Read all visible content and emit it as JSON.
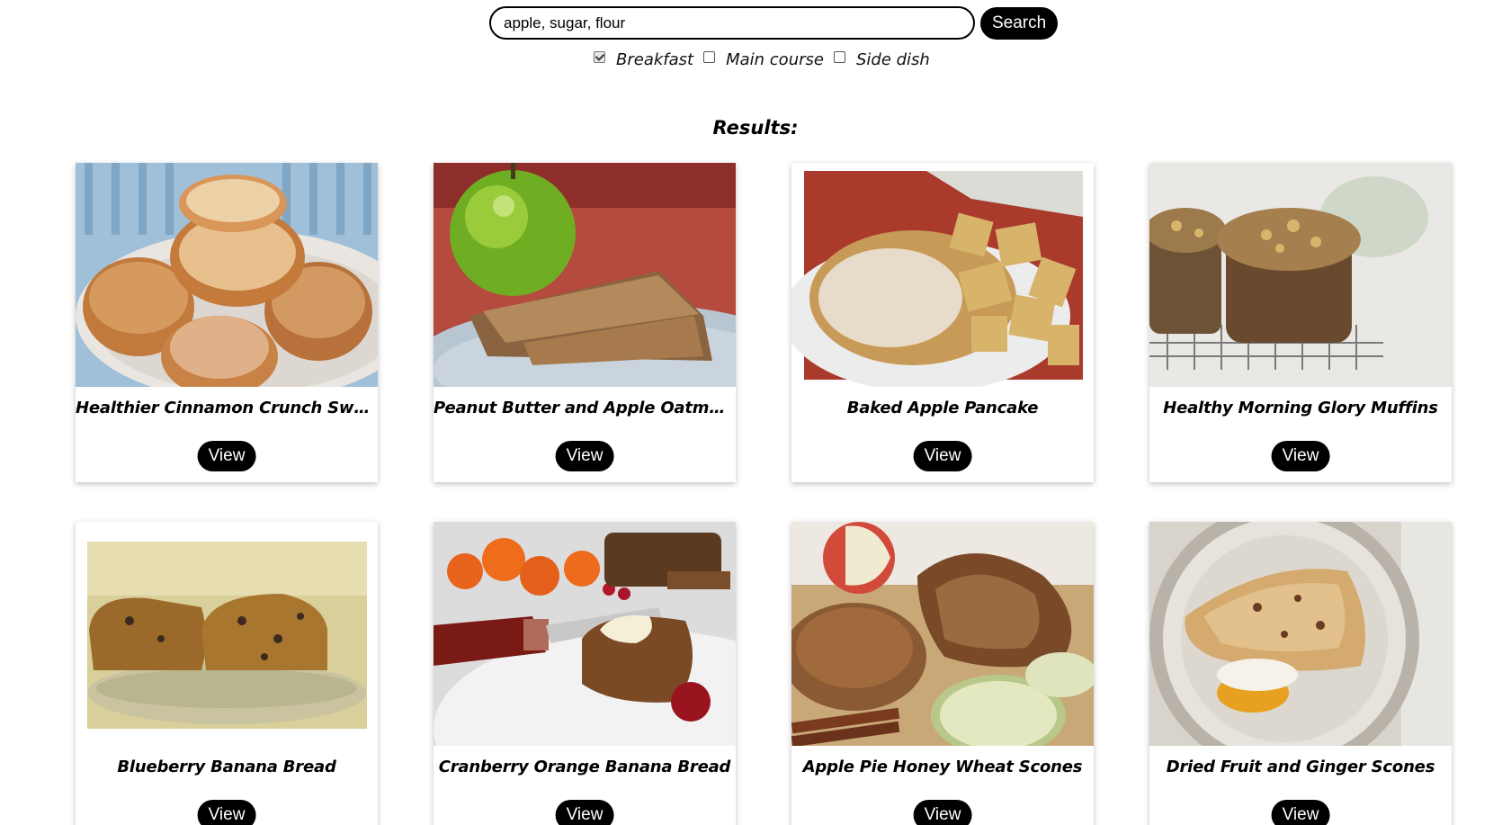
{
  "search": {
    "value": "apple, sugar, flour",
    "button_label": "Search"
  },
  "filters": [
    {
      "label": "Breakfast",
      "checked": true
    },
    {
      "label": "Main course",
      "checked": false
    },
    {
      "label": "Side dish",
      "checked": false
    }
  ],
  "results_heading": "Results:",
  "recipes": [
    {
      "title": "Healthier Cinnamon Crunch Sweet Po...",
      "button": "View"
    },
    {
      "title": "Peanut Butter and Apple Oatmeal Bre...",
      "button": "View"
    },
    {
      "title": "Baked Apple Pancake",
      "button": "View"
    },
    {
      "title": "Healthy Morning Glory Muffins",
      "button": "View"
    },
    {
      "title": "Blueberry Banana Bread",
      "button": "View"
    },
    {
      "title": "Cranberry Orange Banana Bread",
      "button": "View"
    },
    {
      "title": "Apple Pie Honey Wheat Scones",
      "button": "View"
    },
    {
      "title": "Dried Fruit and Ginger Scones",
      "button": "View"
    }
  ]
}
